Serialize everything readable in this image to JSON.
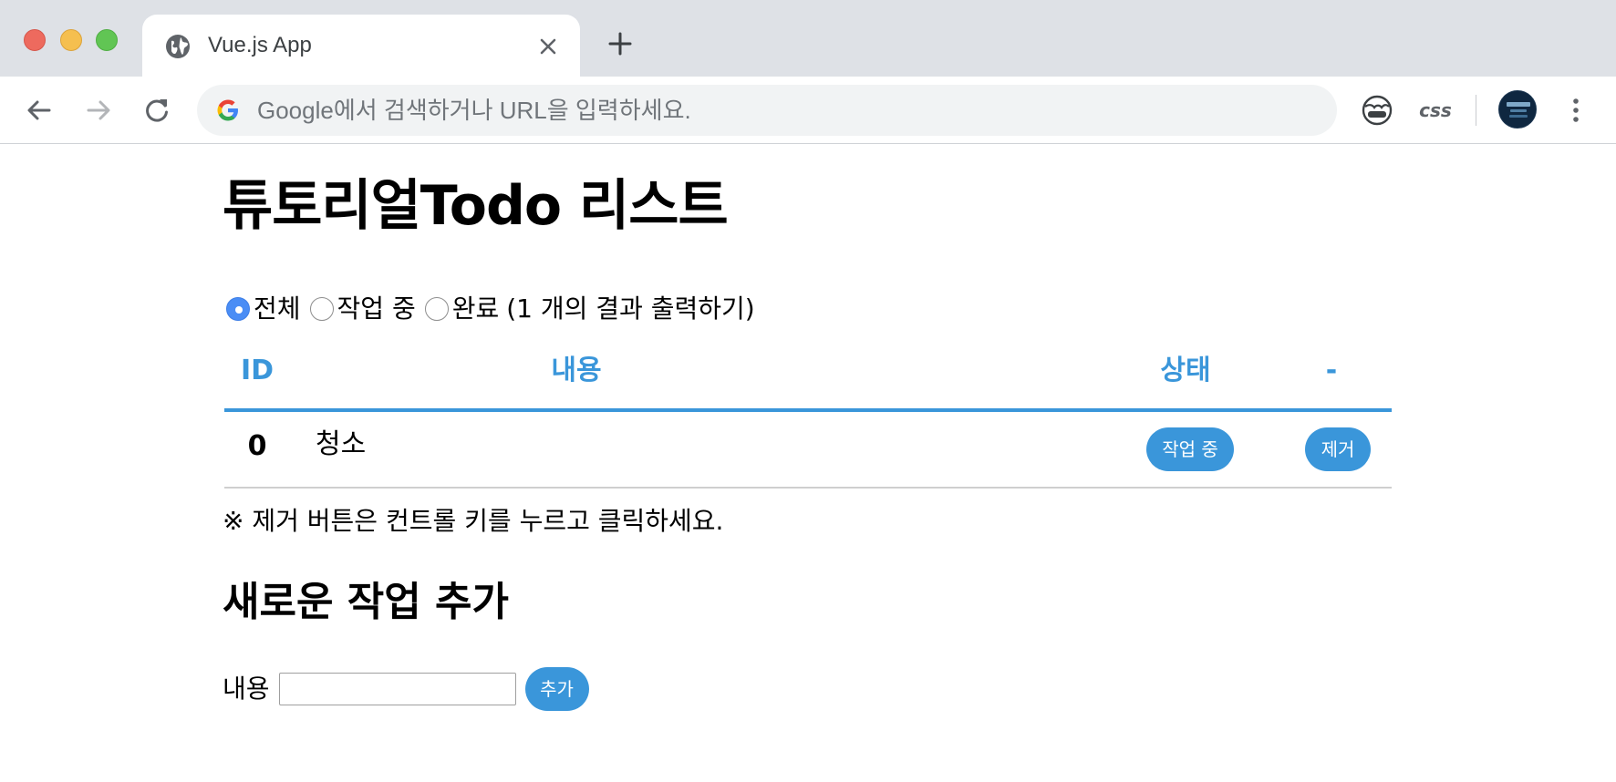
{
  "browser": {
    "tab_title": "Vue.js App",
    "omnibox_placeholder": "Google에서 검색하거나 URL을 입력하세요.",
    "omnibox_value": "",
    "extension_css_label": "css",
    "icons": {
      "tab_favicon": "globe-icon",
      "tab_close": "close-icon",
      "new_tab": "plus-icon",
      "back": "arrow-left-icon",
      "forward": "arrow-right-icon",
      "reload": "reload-icon",
      "omnibox_logo": "google-g-icon",
      "extension_1": "face-extension-icon",
      "menu": "kebab-menu-icon"
    }
  },
  "app": {
    "title": "튜토리얼Todo 리스트",
    "filters": [
      {
        "label": "전체",
        "checked": true
      },
      {
        "label": "작업 중",
        "checked": false
      },
      {
        "label": "완료",
        "checked": false
      }
    ],
    "result_count_text": "(1 개의 결과 출력하기)",
    "table": {
      "headers": {
        "id": "ID",
        "content": "내용",
        "state": "상태",
        "action": "-"
      },
      "rows": [
        {
          "id": "0",
          "content": "청소",
          "state_button": "작업 중",
          "remove_button": "제거"
        }
      ]
    },
    "note": "※ 제거 버튼은 컨트롤 키를 누르고 클릭하세요.",
    "add_section": {
      "title": "새로운 작업 추가",
      "label": "내용",
      "input_value": "",
      "button": "추가"
    }
  },
  "colors": {
    "accent": "#3a96da",
    "radio_checked": "#4a8df5",
    "tabstrip_bg": "#dee1e6",
    "omnibox_bg": "#f1f3f4"
  }
}
